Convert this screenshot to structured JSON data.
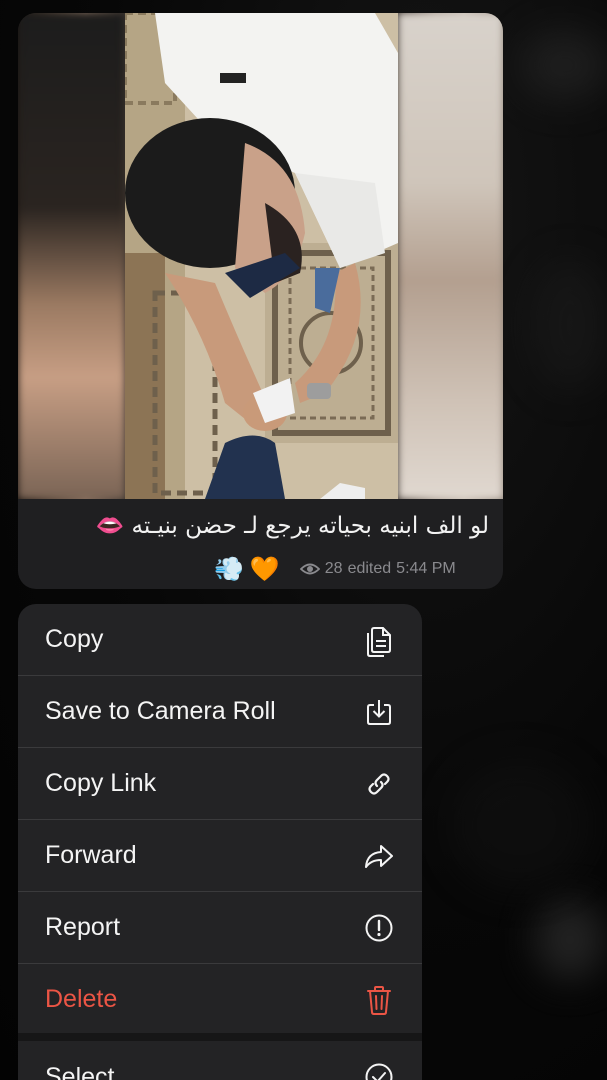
{
  "message": {
    "caption": "لو الف ابنيه بحياته يرجع لـ حضن بنيـته 👄",
    "emojis": [
      "💨",
      "🧡"
    ],
    "views": "28",
    "edited_label": "edited",
    "time": "5:44 PM"
  },
  "menu": {
    "items": [
      {
        "label": "Copy",
        "icon": "copy-icon"
      },
      {
        "label": "Save to Camera Roll",
        "icon": "save-to-camera-roll-icon"
      },
      {
        "label": "Copy Link",
        "icon": "link-icon"
      },
      {
        "label": "Forward",
        "icon": "forward-arrow-icon"
      },
      {
        "label": "Report",
        "icon": "exclamation-circle-icon"
      },
      {
        "label": "Delete",
        "icon": "trash-icon"
      },
      {
        "label": "Select",
        "icon": "select-circle-icon"
      }
    ]
  },
  "colors": {
    "menu_background": "#232325",
    "danger": "#eb5545",
    "bubble_background": "#1f1f21",
    "meta_text": "#8a8a8e"
  }
}
